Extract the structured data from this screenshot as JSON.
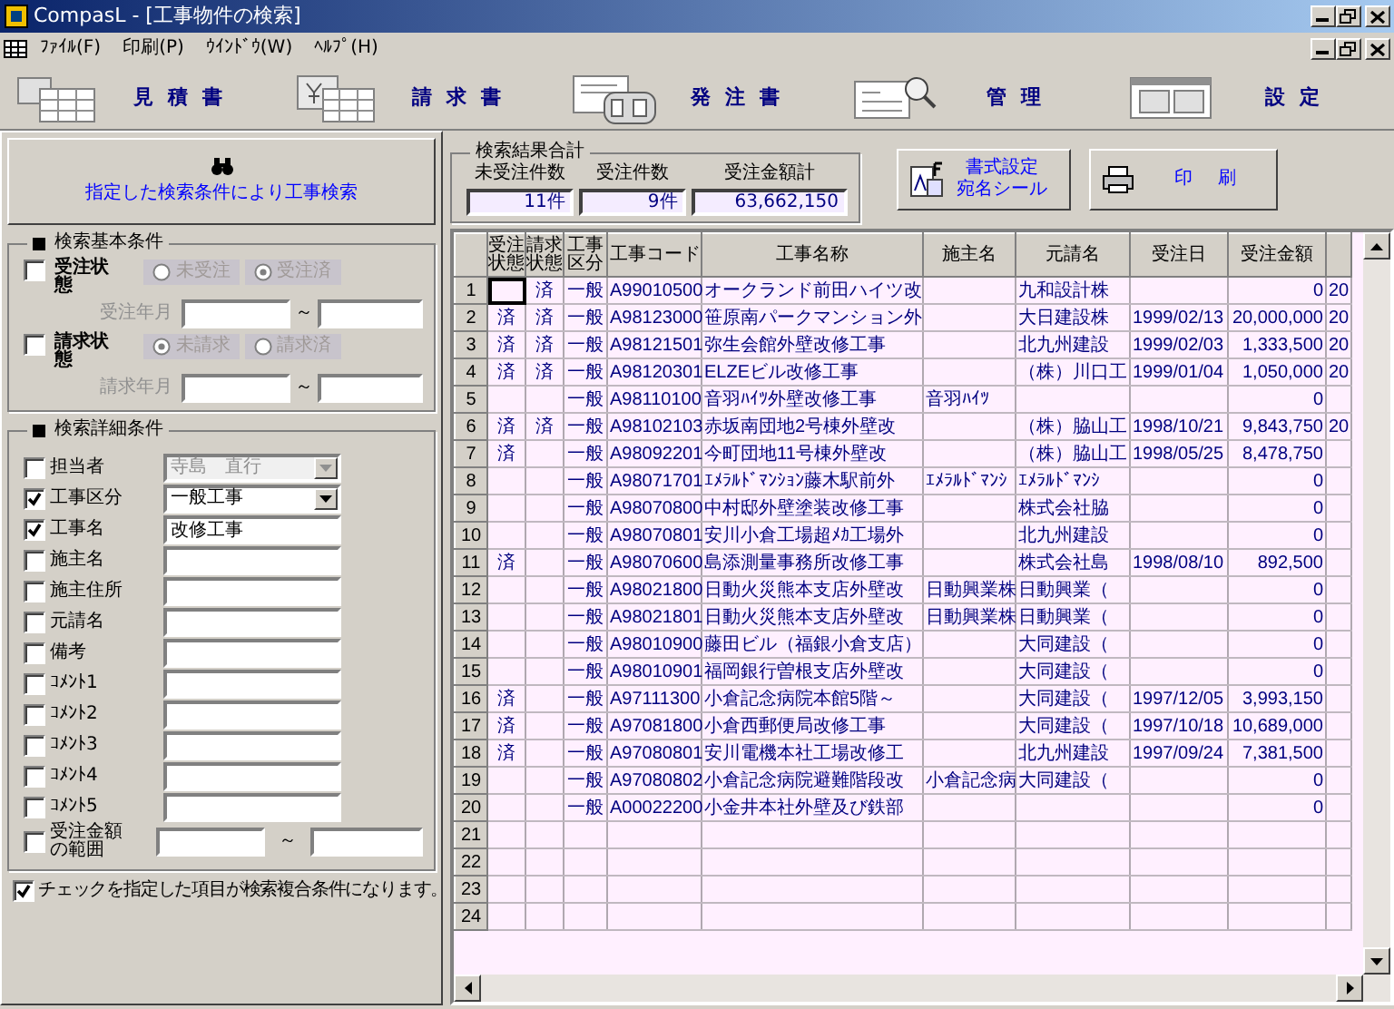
{
  "window": {
    "title": "CompasL - [工事物件の検索]"
  },
  "menu": [
    "ﾌｧｲﾙ(F)",
    "印刷(P)",
    "ｳｲﾝﾄﾞｳ(W)",
    "ﾍﾙﾌﾟ(H)"
  ],
  "toolbar": [
    {
      "label": "見積書",
      "kind": "estimate"
    },
    {
      "label": "請求書",
      "kind": "invoice"
    },
    {
      "label": "発注書",
      "kind": "order"
    },
    {
      "label": "管理",
      "kind": "manage"
    },
    {
      "label": "設定",
      "kind": "settings"
    }
  ],
  "search_button": {
    "label": "指定した検索条件により工事検索"
  },
  "basic_conditions": {
    "title": "検索基本条件",
    "groups": [
      {
        "label": "受注状態",
        "checked": false,
        "options": [
          {
            "label": "未受注",
            "selected": false
          },
          {
            "label": "受注済",
            "selected": true
          }
        ],
        "range_label": "受注年月",
        "separator": "～"
      },
      {
        "label": "請求状態",
        "checked": false,
        "options": [
          {
            "label": "未請求",
            "selected": true
          },
          {
            "label": "請求済",
            "selected": false
          }
        ],
        "range_label": "請求年月",
        "separator": "～"
      }
    ]
  },
  "detail_conditions": {
    "title": "検索詳細条件",
    "fields": [
      {
        "label": "担当者",
        "checked": false,
        "kind": "combo",
        "value": "寺島　直行",
        "disabled": true
      },
      {
        "label": "工事区分",
        "checked": true,
        "kind": "combo",
        "value": "一般工事",
        "disabled": false
      },
      {
        "label": "工事名",
        "checked": true,
        "kind": "text",
        "value": "改修工事"
      },
      {
        "label": "施主名",
        "checked": false,
        "kind": "text"
      },
      {
        "label": "施主住所",
        "checked": false,
        "kind": "text"
      },
      {
        "label": "元請名",
        "checked": false,
        "kind": "text"
      },
      {
        "label": "備考",
        "checked": false,
        "kind": "text"
      },
      {
        "label": "ｺﾒﾝﾄ1",
        "checked": false,
        "kind": "text"
      },
      {
        "label": "ｺﾒﾝﾄ2",
        "checked": false,
        "kind": "text"
      },
      {
        "label": "ｺﾒﾝﾄ3",
        "checked": false,
        "kind": "text"
      },
      {
        "label": "ｺﾒﾝﾄ4",
        "checked": false,
        "kind": "text"
      },
      {
        "label": "ｺﾒﾝﾄ5",
        "checked": false,
        "kind": "text"
      },
      {
        "label": "受注金額の範囲",
        "checked": false,
        "kind": "range",
        "separator": "～"
      }
    ]
  },
  "note": {
    "checked": true,
    "text": "チェックを指定した項目が検索複合条件になります。"
  },
  "summary": {
    "title": "検索結果合計",
    "items": [
      {
        "label": "未受注件数",
        "value": "11件"
      },
      {
        "label": "受注件数",
        "value": "9件"
      },
      {
        "label": "受注金額計",
        "value": "63,662,150"
      }
    ]
  },
  "actions": [
    {
      "kind": "label",
      "label": "書式設定",
      "sublabel": "宛名シール"
    },
    {
      "kind": "print",
      "label": "印刷"
    }
  ],
  "grid": {
    "columns": [
      {
        "label": "受注状態"
      },
      {
        "label": "請求状態"
      },
      {
        "label": "工事区分"
      },
      {
        "label": "工事コード"
      },
      {
        "label": "工事名称"
      },
      {
        "label": "施主名"
      },
      {
        "label": "元請名"
      },
      {
        "label": "受注日"
      },
      {
        "label": "受注金額"
      }
    ],
    "rows": [
      {
        "no": "1",
        "selected": true,
        "billed": "済",
        "type": "一般",
        "code": "A99010500",
        "name": "オークランド前田ハイツ改",
        "contractor": "九和設計株",
        "amount": "0",
        "column_11": "20"
      },
      {
        "no": "2",
        "selected": false,
        "received": "済",
        "billed": "済",
        "type": "一般",
        "code": "A98123000",
        "name": "笹原南パークマンション外",
        "contractor": "大日建設株",
        "date": "1999/02/13",
        "amount": "20,000,000",
        "column_11": "20"
      },
      {
        "no": "3",
        "selected": false,
        "received": "済",
        "billed": "済",
        "type": "一般",
        "code": "A98121501",
        "name": "弥生会館外壁改修工事",
        "contractor": "北九州建設",
        "date": "1999/02/03",
        "amount": "1,333,500",
        "column_11": "20"
      },
      {
        "no": "4",
        "selected": false,
        "received": "済",
        "billed": "済",
        "type": "一般",
        "code": "A98120301",
        "name": "ELZEビル改修工事",
        "contractor": "（株）川口工",
        "date": "1999/01/04",
        "amount": "1,050,000",
        "column_11": "20"
      },
      {
        "no": "5",
        "selected": false,
        "type": "一般",
        "code": "A98110100",
        "name": "音羽ﾊｲﾂ外壁改修工事",
        "owner": "音羽ﾊｲﾂ",
        "amount": "0"
      },
      {
        "no": "6",
        "selected": false,
        "received": "済",
        "billed": "済",
        "type": "一般",
        "code": "A98102103",
        "name": "赤坂南団地2号棟外壁改",
        "contractor": "（株）脇山工",
        "date": "1998/10/21",
        "amount": "9,843,750",
        "column_11": "20"
      },
      {
        "no": "7",
        "selected": false,
        "received": "済",
        "type": "一般",
        "code": "A98092201",
        "name": "今町団地11号棟外壁改",
        "contractor": "（株）脇山工",
        "date": "1998/05/25",
        "amount": "8,478,750"
      },
      {
        "no": "8",
        "selected": false,
        "type": "一般",
        "code": "A98071701",
        "name": "ｴﾒﾗﾙﾄﾞﾏﾝｼｮﾝ藤木駅前外",
        "owner": "ｴﾒﾗﾙﾄﾞﾏﾝｼ",
        "contractor": "ｴﾒﾗﾙﾄﾞﾏﾝｼ",
        "amount": "0"
      },
      {
        "no": "9",
        "selected": false,
        "type": "一般",
        "code": "A98070800",
        "name": "中村邸外壁塗装改修工事",
        "contractor": "株式会社脇",
        "amount": "0"
      },
      {
        "no": "10",
        "selected": false,
        "type": "一般",
        "code": "A98070801",
        "name": "安川小倉工場超ﾒｶ工場外",
        "contractor": "北九州建設",
        "amount": "0"
      },
      {
        "no": "11",
        "selected": false,
        "received": "済",
        "type": "一般",
        "code": "A98070600",
        "name": "島添測量事務所改修工事",
        "contractor": "株式会社島",
        "date": "1998/08/10",
        "amount": "892,500"
      },
      {
        "no": "12",
        "selected": false,
        "type": "一般",
        "code": "A98021800",
        "name": "日動火災熊本支店外壁改",
        "owner": "日動興業株",
        "contractor": "日動興業（",
        "amount": "0"
      },
      {
        "no": "13",
        "selected": false,
        "type": "一般",
        "code": "A98021801",
        "name": "日動火災熊本支店外壁改",
        "owner": "日動興業株",
        "contractor": "日動興業（",
        "amount": "0"
      },
      {
        "no": "14",
        "selected": false,
        "type": "一般",
        "code": "A98010900",
        "name": "藤田ビル（福銀小倉支店）",
        "contractor": "大同建設（",
        "amount": "0"
      },
      {
        "no": "15",
        "selected": false,
        "type": "一般",
        "code": "A98010901",
        "name": "福岡銀行曽根支店外壁改",
        "contractor": "大同建設（",
        "amount": "0"
      },
      {
        "no": "16",
        "selected": false,
        "received": "済",
        "type": "一般",
        "code": "A97111300",
        "name": "小倉記念病院本館5階～",
        "contractor": "大同建設（",
        "date": "1997/12/05",
        "amount": "3,993,150"
      },
      {
        "no": "17",
        "selected": false,
        "received": "済",
        "type": "一般",
        "code": "A97081800",
        "name": "小倉西郵便局改修工事",
        "contractor": "大同建設（",
        "date": "1997/10/18",
        "amount": "10,689,000"
      },
      {
        "no": "18",
        "selected": false,
        "received": "済",
        "type": "一般",
        "code": "A97080801",
        "name": "安川電機本社工場改修工",
        "contractor": "北九州建設",
        "date": "1997/09/24",
        "amount": "7,381,500"
      },
      {
        "no": "19",
        "selected": false,
        "type": "一般",
        "code": "A97080802",
        "name": "小倉記念病院避難階段改",
        "owner": "小倉記念病",
        "contractor": "大同建設（",
        "amount": "0"
      },
      {
        "no": "20",
        "selected": false,
        "type": "一般",
        "code": "A00022200",
        "name": "小金井本社外壁及び鉄部",
        "amount": "0"
      },
      {
        "no": "21",
        "selected": false
      },
      {
        "no": "22",
        "selected": false
      },
      {
        "no": "23",
        "selected": false
      },
      {
        "no": "24",
        "selected": false
      }
    ]
  }
}
